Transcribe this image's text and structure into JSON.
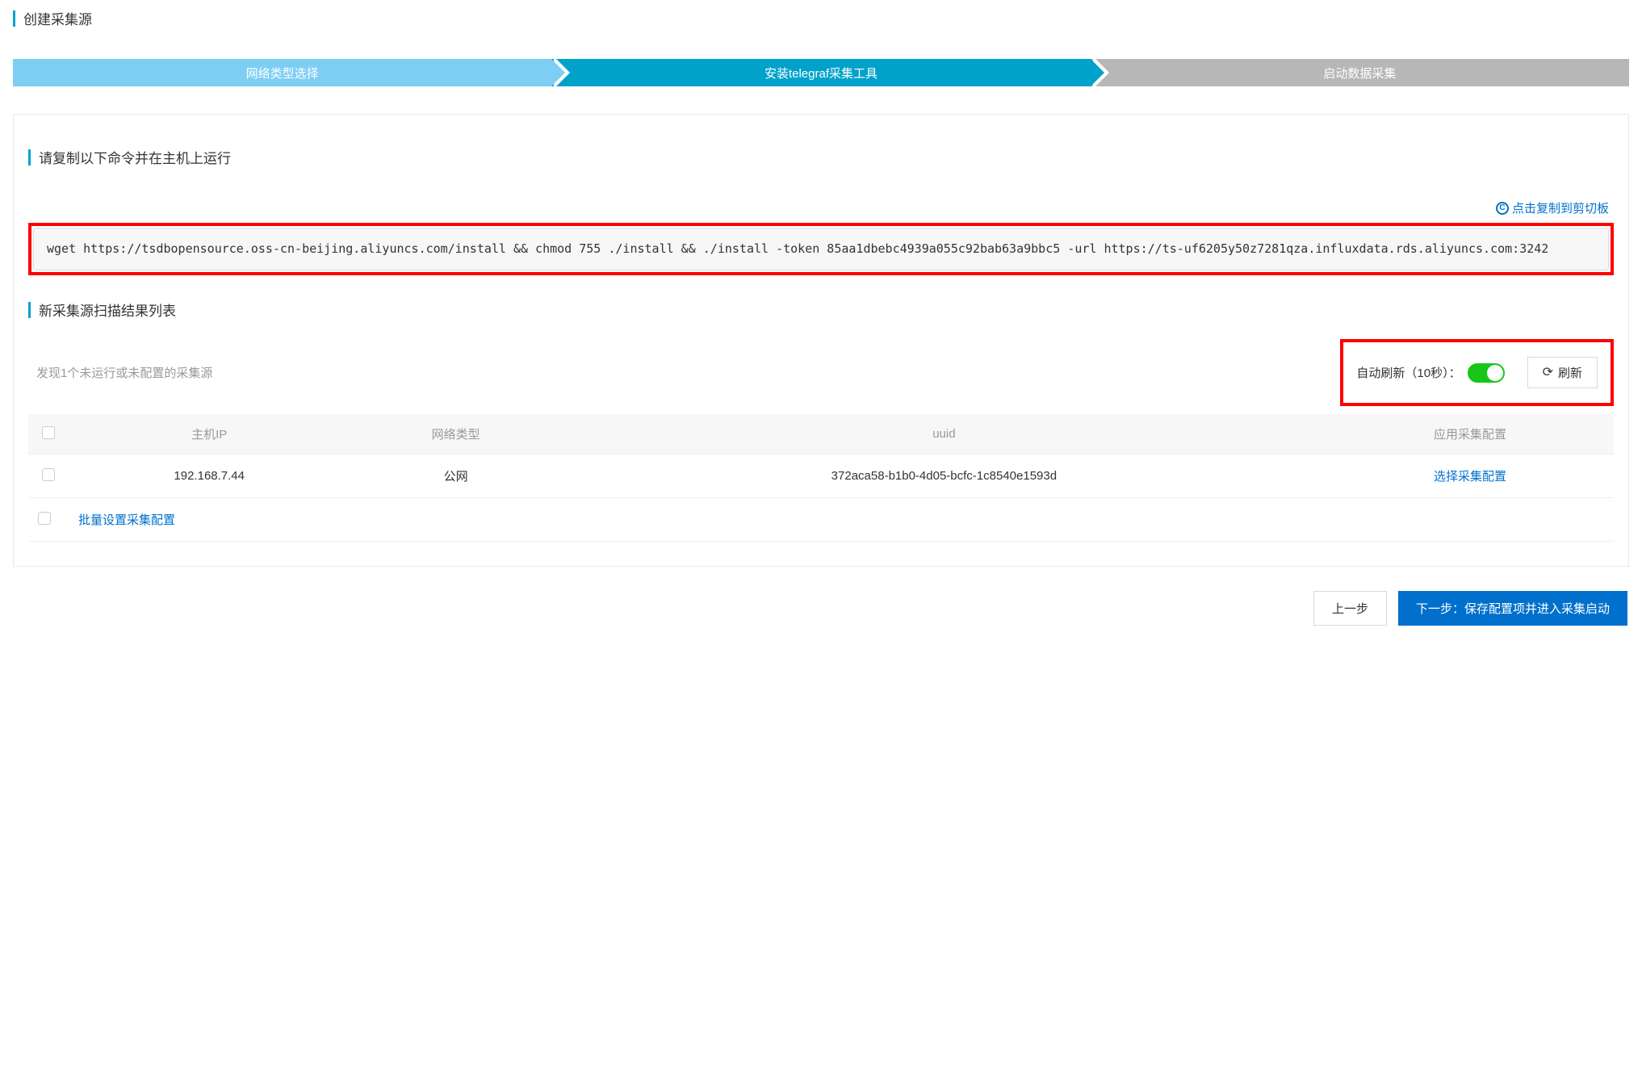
{
  "pageTitle": "创建采集源",
  "steps": {
    "s1": "网络类型选择",
    "s2": "安装telegraf采集工具",
    "s3": "启动数据采集"
  },
  "section1": {
    "title": "请复制以下命令并在主机上运行",
    "copyLink": "点击复制到剪切板",
    "command": "wget https://tsdbopensource.oss-cn-beijing.aliyuncs.com/install && chmod 755 ./install && ./install -token 85aa1dbebc4939a055c92bab63a9bbc5 -url https://ts-uf6205y50z7281qza.influxdata.rds.aliyuncs.com:3242"
  },
  "section2": {
    "title": "新采集源扫描结果列表",
    "scanMsg": "发现1个未运行或未配置的采集源",
    "autoRefreshLabel": "自动刷新（10秒）：",
    "refreshBtn": "刷新"
  },
  "table": {
    "headers": {
      "hostIp": "主机IP",
      "networkType": "网络类型",
      "uuid": "uuid",
      "config": "应用采集配置"
    },
    "rows": [
      {
        "hostIp": "192.168.7.44",
        "networkType": "公网",
        "uuid": "372aca58-b1b0-4d05-bcfc-1c8540e1593d",
        "action": "选择采集配置"
      }
    ],
    "batchAction": "批量设置采集配置"
  },
  "footer": {
    "prev": "上一步",
    "next": "下一步：保存配置项并进入采集启动"
  }
}
